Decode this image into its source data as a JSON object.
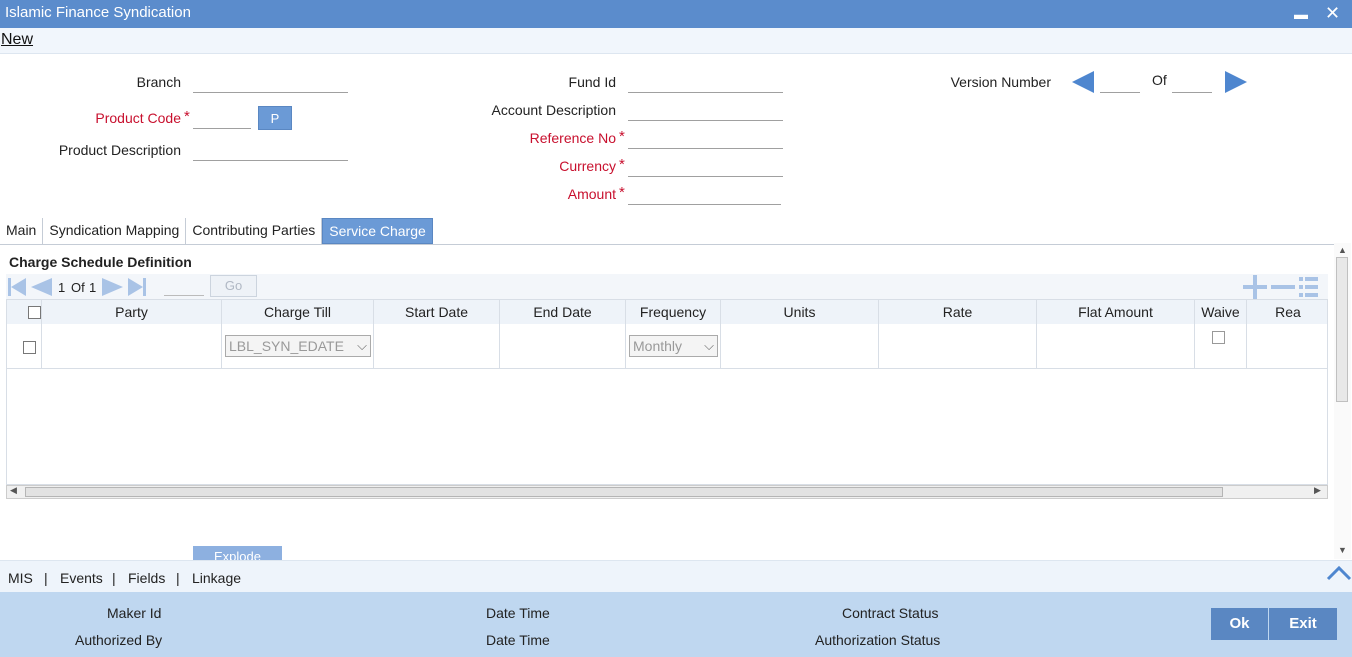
{
  "window": {
    "title": "Islamic Finance Syndication",
    "minimize": "▬",
    "close": "✕"
  },
  "menu": {
    "new_label": "New"
  },
  "form": {
    "branch_label": "Branch",
    "product_code_label": "Product Code",
    "product_desc_label": "Product Description",
    "p_button": "P",
    "fund_id_label": "Fund Id",
    "account_desc_label": "Account Description",
    "reference_no_label": "Reference No",
    "currency_label": "Currency",
    "amount_label": "Amount",
    "version_label": "Version Number",
    "of_label": "Of",
    "required_mark": "*"
  },
  "tabs": [
    "Main",
    "Syndication Mapping",
    "Contributing Parties",
    "Service Charge"
  ],
  "active_tab": "Service Charge",
  "section": {
    "title": "Charge Schedule Definition"
  },
  "pager": {
    "current": "1",
    "of": "Of",
    "total": "1",
    "go": "Go"
  },
  "grid": {
    "columns": [
      "Party",
      "Charge Till",
      "Start Date",
      "End Date",
      "Frequency",
      "Units",
      "Rate",
      "Flat Amount",
      "Waive",
      "Rea"
    ],
    "rows": [
      {
        "party": "",
        "charge_till": "LBL_SYN_EDATE",
        "start_date": "",
        "end_date": "",
        "frequency": "Monthly",
        "units": "",
        "rate": "",
        "flat_amount": "",
        "waive": false
      }
    ]
  },
  "explode_button": "Explode",
  "bottom_links": [
    "MIS",
    "Events",
    "Fields",
    "Linkage"
  ],
  "footer": {
    "maker_id": "Maker Id",
    "authorized_by": "Authorized By",
    "date_time_1": "Date Time",
    "date_time_2": "Date Time",
    "contract_status": "Contract Status",
    "authorization_status": "Authorization Status",
    "ok": "Ok",
    "exit": "Exit"
  },
  "colors": {
    "titlebar": "#5b8ccc",
    "accent": "#5a87c2",
    "required": "#c8102e",
    "footer": "#bfd7f0"
  }
}
